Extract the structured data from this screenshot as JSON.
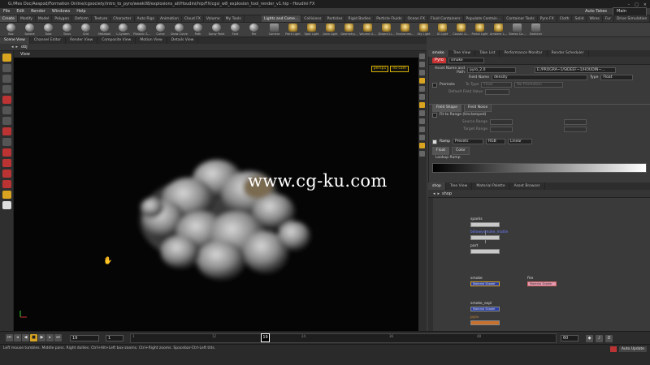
{
  "title_bar": {
    "text": "G:/Mes Doc/Aespod/Formation Online/cgsociety/intro_to_pyro/week08/explosions_all/Houdini/hip/FX/cgsi_w8_explosion_tool_render_v1.hip - Houdini FX"
  },
  "menu": {
    "items": [
      "File",
      "Edit",
      "Render",
      "Windows",
      "Help"
    ],
    "auto_takes": "Auto Takes",
    "takes_value": "Main"
  },
  "shelf_tabs": {
    "left": [
      "Create",
      "Modify",
      "Model",
      "Polygon",
      "Deform",
      "Texture",
      "Character",
      "Auto Rigs",
      "Animation",
      "Cloud FX",
      "Volume",
      "My Tools"
    ],
    "right": [
      "Lights and Came...",
      "Collisions",
      "Particles",
      "Rigid Bodies",
      "Particle Fluids",
      "Ocean FX",
      "Fluid Containers",
      "Populate Contain...",
      "Container Tools",
      "Pyro FX",
      "Cloth",
      "Solid",
      "Wires",
      "Fur",
      "Drive Simulation"
    ]
  },
  "shelf_tools": {
    "left": [
      "Box",
      "Sphere",
      "Tube",
      "Torus",
      "Grid",
      "Metaball",
      "L-System",
      "Platonic S...",
      "Curve",
      "Draw Curve",
      "Path",
      "Spray Paint",
      "Font",
      "File"
    ],
    "right": [
      "Camera",
      "Point Light",
      "Spot Light",
      "Area Light",
      "Geometry...",
      "Volume Li...",
      "Distant Li...",
      "Environme...",
      "Sky Light",
      "GI Light",
      "Caustic Li...",
      "Portal Light",
      "Ambient L...",
      "Stereo Ca...",
      "Switcher"
    ]
  },
  "left_tabs": [
    "Scene View",
    "Channel Editor",
    "Render View",
    "Composite View",
    "Motion View",
    "Details View"
  ],
  "path": "obj",
  "view_label": "View",
  "viewport": {
    "cam1": "persp1",
    "cam2": "no cam",
    "watermark": "www.cg-ku.com"
  },
  "right_tabs": [
    "smoke",
    "Tree View",
    "Take List",
    "Performance Monitor",
    "Render Scheduler"
  ],
  "parm": {
    "node_type": "Pyro",
    "node_name": "smoke",
    "asset_label": "Asset Name and Path",
    "asset_value": "pyro_2.0",
    "asset_path": "E:/PROGRA~1/SIDEEF~1/HOUDIN~...",
    "field_name_label": "Field Name",
    "field_name_value": "density",
    "type_label": "Type",
    "type_value": "Float",
    "promote_label": "Promote",
    "to_type_label": "To Type",
    "to_type_value": "Float",
    "no_promotion": "No Promotion",
    "default_field_label": "Default Field Value",
    "tabs": [
      "Field Shape",
      "Field Noise"
    ],
    "fit_label": "Fit to Range (Unclamped)",
    "source_range": "Source Range",
    "target_range": "Target Range",
    "ramp_label": "Ramp",
    "ramp_preset": "Presets",
    "ramp_rgb": "RGB",
    "ramp_linear": "Linear",
    "float_label": "Float",
    "color_label": "Color",
    "lookup_label": "Lookup Ramp"
  },
  "net_tabs": [
    "shop",
    "Tree View",
    "Material Palette",
    "Asset Browser"
  ],
  "net_path": "shop",
  "nodes": [
    {
      "name": "sparks",
      "color": "grey"
    },
    {
      "name": "part",
      "color": "grey"
    },
    {
      "name": "billowysmoke_matte",
      "color": "grey"
    },
    {
      "name": "smoke",
      "sub": "Material Shader",
      "color": "blue"
    },
    {
      "name": "fire",
      "sub": "Material Shader",
      "color": "pink"
    },
    {
      "name": "smoke_expl",
      "sub": "Material Shader",
      "color": "blue"
    },
    {
      "name": "pyro",
      "color": "orange"
    }
  ],
  "timeline": {
    "current_frame": "19",
    "start": "1",
    "end": "60",
    "ticks": [
      "1",
      "12",
      "24",
      "36",
      "48"
    ],
    "ruler_frame": "19"
  },
  "status": {
    "message": "Left mouse tumbles. Middle pans. Right dollies. Ctrl+Alt+Left box-zooms. Ctrl+Right zooms. Spacebar-Ctrl-Left tilts.",
    "auto_update": "Auto Update"
  }
}
